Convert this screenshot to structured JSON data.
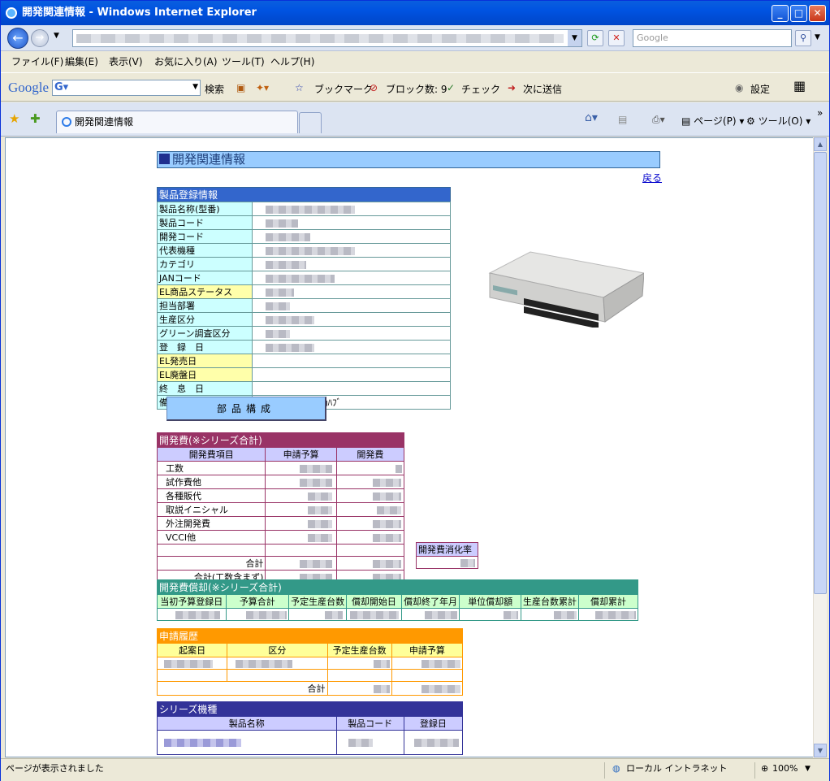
{
  "window": {
    "title": "開発関連情報 - Windows Internet Explorer"
  },
  "nav": {
    "search_placeholder": "Google"
  },
  "menu": [
    "ファイル(F)",
    "編集(E)",
    "表示(V)",
    "お気に入り(A)",
    "ツール(T)",
    "ヘルプ(H)"
  ],
  "gtoolbar": {
    "logo": "Google",
    "search_label": "検索",
    "bookmark": "ブックマーク",
    "blocked": "ブロック数: 9",
    "check": "チェック",
    "send": "次に送信",
    "settings": "設定"
  },
  "tabs": {
    "active": "開発関連情報",
    "page": "ページ(P)",
    "tools": "ツール(O)"
  },
  "page": {
    "title": "開発関連情報",
    "back_link": "戻る",
    "product": {
      "header": "製品登録情報",
      "rows": [
        {
          "label": "製品名称(型番)",
          "value": ""
        },
        {
          "label": "製品コード",
          "value": ""
        },
        {
          "label": "開発コード",
          "value": ""
        },
        {
          "label": "代表機種",
          "value": ""
        },
        {
          "label": "カテゴリ",
          "value": ""
        },
        {
          "label": "JANコード",
          "value": ""
        },
        {
          "label": "EL商品ステータス",
          "value": ""
        },
        {
          "label": "担当部署",
          "value": ""
        },
        {
          "label": "生産区分",
          "value": ""
        },
        {
          "label": "グリーン調査区分",
          "value": ""
        },
        {
          "label": "登　録　日",
          "value": ""
        },
        {
          "label": "EL発売日",
          "value": ""
        },
        {
          "label": "EL廃盤日",
          "value": ""
        },
        {
          "label": "終　息　日",
          "value": ""
        },
        {
          "label": "備　　考",
          "value": "GigaSwitchingﾊﾌﾞ"
        }
      ]
    },
    "parts_button": "部品構成",
    "dev_cost": {
      "header": "開発費(※シリーズ合計)",
      "columns": [
        "開発費項目",
        "申請予算",
        "開発費"
      ],
      "items": [
        "工数",
        "試作費他",
        "各種販代",
        "取説イニシャル",
        "外注開発費",
        "VCCI他",
        ""
      ],
      "total": "合計",
      "total_with_hours": "合計(工数含まず)",
      "rate_label": "開発費消化率"
    },
    "amortization": {
      "header": "開発費償却(※シリーズ合計)",
      "columns": [
        "当初予算登録日",
        "予算合計",
        "予定生産台数",
        "償却開始日",
        "償却終了年月",
        "単位償却額",
        "生産台数累計",
        "償却累計"
      ]
    },
    "application": {
      "header": "申請履歴",
      "columns": [
        "起案日",
        "区分",
        "予定生産台数",
        "申請予算"
      ],
      "total": "合計"
    },
    "series": {
      "header": "シリーズ機種",
      "columns": [
        "製品名称",
        "製品コード",
        "登録日"
      ]
    }
  },
  "status": {
    "text": "ページが表示されました",
    "zone": "ローカル イントラネット",
    "zoom": "100%"
  }
}
